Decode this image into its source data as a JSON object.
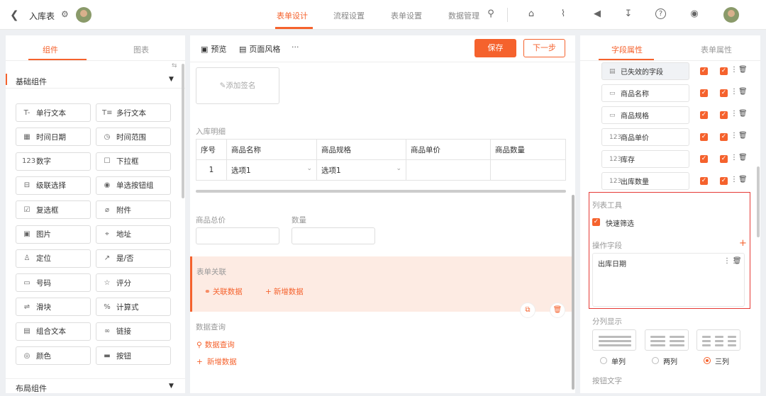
{
  "header": {
    "back_icon": "chevron-left-icon",
    "title": "入库表",
    "tabs": [
      {
        "label": "表单设计",
        "active": true
      },
      {
        "label": "流程设置",
        "active": false
      },
      {
        "label": "表单设置",
        "active": false
      },
      {
        "label": "数据管理",
        "active": false
      }
    ],
    "accent": "#f5622d",
    "icons": [
      "search-icon",
      "home-icon",
      "shirt-icon",
      "megaphone-icon",
      "download-icon",
      "help-icon",
      "settings-icon"
    ]
  },
  "left_panel": {
    "tabs": [
      "组件",
      "图表"
    ],
    "active_tab": "组件",
    "section_basic": "基础组件",
    "section_layout": "布局组件",
    "components": [
      {
        "label": "单行文本",
        "icon": "T-"
      },
      {
        "label": "多行文本",
        "icon": "T≡"
      },
      {
        "label": "时间日期",
        "icon": "▦"
      },
      {
        "label": "时间范围",
        "icon": "◷"
      },
      {
        "label": "数字",
        "icon": "123"
      },
      {
        "label": "下拉框",
        "icon": "☐"
      },
      {
        "label": "级联选择",
        "icon": "⊟"
      },
      {
        "label": "单选按钮组",
        "icon": "◉"
      },
      {
        "label": "复选框",
        "icon": "☑"
      },
      {
        "label": "附件",
        "icon": "⌀"
      },
      {
        "label": "图片",
        "icon": "▣"
      },
      {
        "label": "地址",
        "icon": "⌖"
      },
      {
        "label": "定位",
        "icon": "♙"
      },
      {
        "label": "是/否",
        "icon": "↗"
      },
      {
        "label": "号码",
        "icon": "▭"
      },
      {
        "label": "评分",
        "icon": "☆"
      },
      {
        "label": "滑块",
        "icon": "⇌"
      },
      {
        "label": "计算式",
        "icon": "%"
      },
      {
        "label": "组合文本",
        "icon": "▤"
      },
      {
        "label": "链接",
        "icon": "∞"
      },
      {
        "label": "颜色",
        "icon": "◎"
      },
      {
        "label": "按钮",
        "icon": "▬"
      }
    ]
  },
  "center": {
    "toolbar": {
      "preview": "预览",
      "page_style": "页面风格",
      "more": "···",
      "save": "保存",
      "next": "下一步"
    },
    "signature": "添加签名",
    "detail_title": "入库明细",
    "table_headers": [
      "序号",
      "商品名称",
      "商品规格",
      "商品单价",
      "商品数量"
    ],
    "table_row": {
      "no": "1",
      "name": "选项1",
      "spec": "选项1",
      "price": "",
      "qty": ""
    },
    "total_price": "商品总价",
    "quantity": "数量",
    "form_link": {
      "title": "表单关联",
      "link_data": "关联数据",
      "add_data": "新增数据"
    },
    "data_query": {
      "title": "数据查询",
      "query": "数据查询",
      "add": "新增数据"
    }
  },
  "right_panel": {
    "tabs": [
      "字段属性",
      "表单属性"
    ],
    "active_tab": "字段属性",
    "fields": [
      {
        "label": "已失效的字段",
        "icon": "▤"
      },
      {
        "label": "商品名称",
        "icon": "▭"
      },
      {
        "label": "商品规格",
        "icon": "▭"
      },
      {
        "label": "商品单价",
        "icon": "123"
      },
      {
        "label": "库存",
        "icon": "123"
      },
      {
        "label": "出库数量",
        "icon": "123"
      }
    ],
    "list_tools": "列表工具",
    "quick_filter": "快速筛选",
    "op_fields": "操作字段",
    "op_field_item": "出库日期",
    "column_display": "分列显示",
    "column_options": [
      {
        "label": "单列",
        "selected": false
      },
      {
        "label": "两列",
        "selected": false
      },
      {
        "label": "三列",
        "selected": true
      }
    ],
    "button_text": "按钮文字"
  }
}
